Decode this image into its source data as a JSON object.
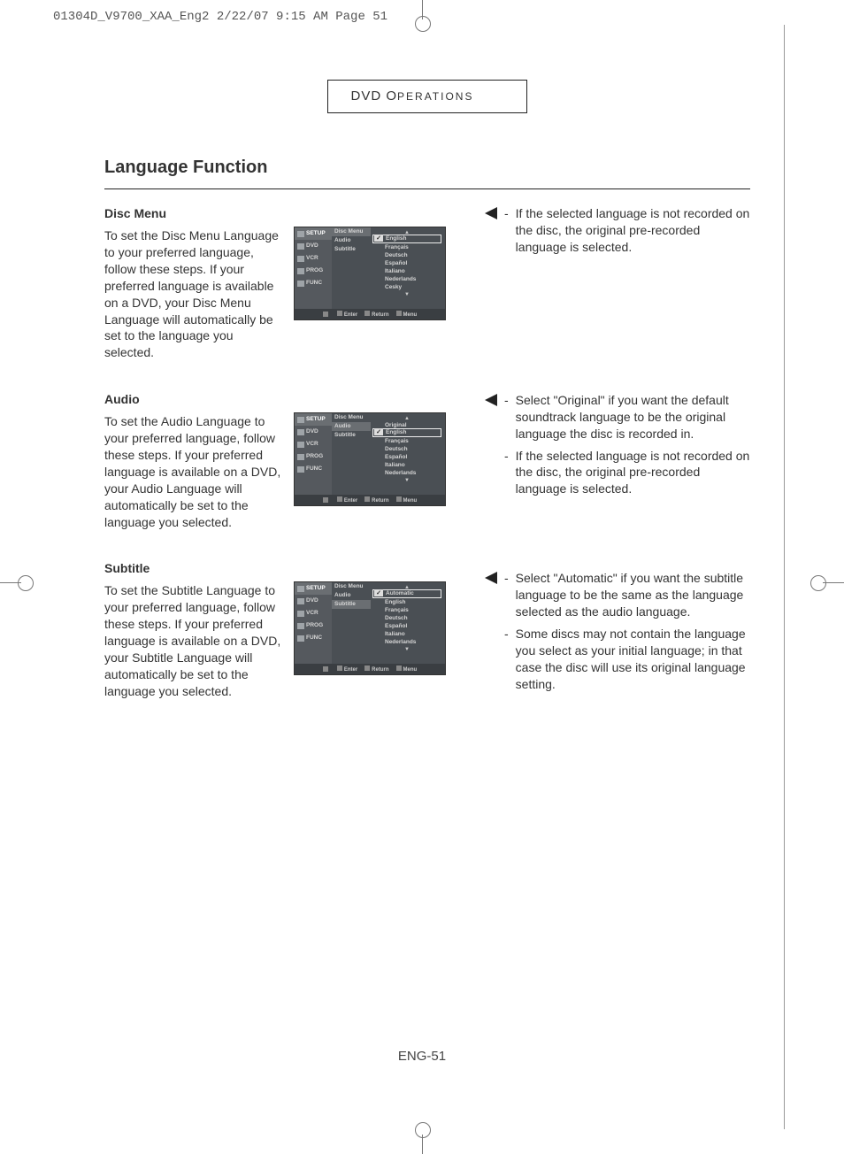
{
  "crop_header": "01304D_V9700_XAA_Eng2  2/22/07  9:15 AM  Page 51",
  "section_label_caps": "DVD O",
  "section_label_sc": "PERATIONS",
  "title": "Language Function",
  "page_number": "ENG-51",
  "left_blocks": [
    {
      "heading": "Disc Menu",
      "body": "To set the Disc Menu Language to your preferred language, follow these steps. If your preferred language is available on a DVD, your Disc Menu Language will automatically be set to the language you selected.",
      "osd": {
        "side": [
          "SETUP",
          "DVD",
          "VCR",
          "PROG",
          "FUNC"
        ],
        "side_hi": 0,
        "mid": [
          "Disc Menu",
          "Audio",
          "Subtitle"
        ],
        "mid_hi": 0,
        "list": [
          "English",
          "Français",
          "Deutsch",
          "Español",
          "Italiano",
          "Nederlands",
          "Cesky"
        ],
        "sel": 0,
        "footer": [
          "Enter",
          "Return",
          "Menu"
        ]
      }
    },
    {
      "heading": "Audio",
      "body": "To set the Audio Language to your preferred language, follow these steps. If your preferred language is available on a DVD, your Audio Language will automatically be set to the language you selected.",
      "osd": {
        "side": [
          "SETUP",
          "DVD",
          "VCR",
          "PROG",
          "FUNC"
        ],
        "side_hi": 0,
        "mid": [
          "Disc Menu",
          "Audio",
          "Subtitle"
        ],
        "mid_hi": 1,
        "list": [
          "Original",
          "English",
          "Français",
          "Deutsch",
          "Español",
          "Italiano",
          "Nederlands"
        ],
        "sel": 1,
        "footer": [
          "Enter",
          "Return",
          "Menu"
        ]
      }
    },
    {
      "heading": "Subtitle",
      "body": "To set the Subtitle Language to your preferred language, follow these steps. If your preferred language is available on a DVD, your Subtitle Language will automatically be set to the language you selected.",
      "osd": {
        "side": [
          "SETUP",
          "DVD",
          "VCR",
          "PROG",
          "FUNC"
        ],
        "side_hi": 0,
        "mid": [
          "Disc Menu",
          "Audio",
          "Subtitle"
        ],
        "mid_hi": 2,
        "list": [
          "Automatic",
          "English",
          "Français",
          "Deutsch",
          "Español",
          "Italiano",
          "Nederlands"
        ],
        "sel": 0,
        "footer": [
          "Enter",
          "Return",
          "Menu"
        ]
      }
    }
  ],
  "right_notes": [
    [
      {
        "arrow": true,
        "text": "If the selected language is not recorded on the disc, the original pre-recorded language is selected."
      }
    ],
    [
      {
        "arrow": true,
        "text": "Select \"Original\" if you want the default soundtrack language to be the original language the disc is recorded in."
      },
      {
        "arrow": false,
        "text": "If the selected language is not recorded on the disc, the original pre-recorded language is selected."
      }
    ],
    [
      {
        "arrow": true,
        "text": "Select \"Automatic\" if you want the subtitle language to be the same as the language selected as the audio language."
      },
      {
        "arrow": false,
        "text": "Some discs may not contain the language you select as your initial language; in that case the disc will use its original  language setting."
      }
    ]
  ]
}
